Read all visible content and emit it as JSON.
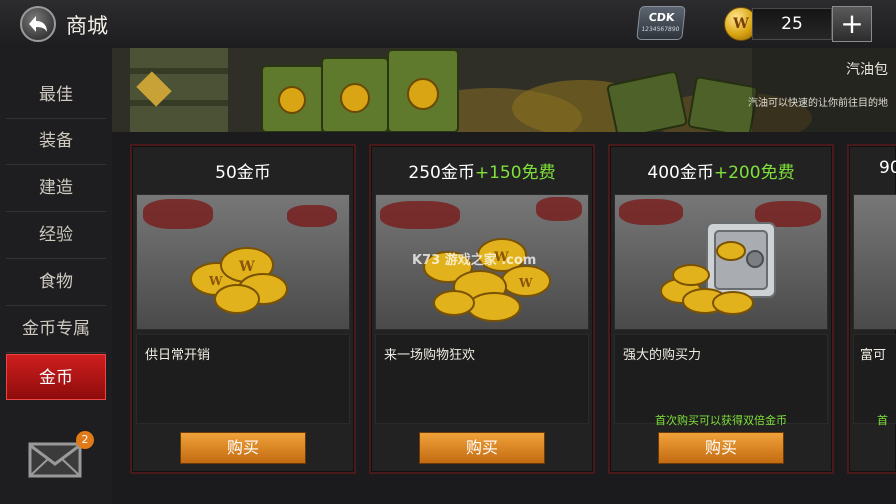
{
  "header": {
    "title": "商城",
    "cdk_label": "CDK",
    "cdk_sub": "1234567890",
    "coin_glyph": "W",
    "currency_amount": "25",
    "add_label": "+"
  },
  "sidebar": {
    "items": [
      {
        "label": "最佳",
        "active": false
      },
      {
        "label": "装备",
        "active": false
      },
      {
        "label": "建造",
        "active": false
      },
      {
        "label": "经验",
        "active": false
      },
      {
        "label": "食物",
        "active": false
      },
      {
        "label": "金币专属",
        "active": false
      },
      {
        "label": "金币",
        "active": true
      }
    ],
    "mail_badge": "2"
  },
  "banner": {
    "title": "汽油包",
    "description": "汽油可以快速的让你前往目的地"
  },
  "cards": [
    {
      "title": "50金币",
      "bonus": "",
      "description": "供日常开销",
      "note": "",
      "buy_label": "购买"
    },
    {
      "title": "250金币",
      "bonus": "+150免费",
      "description": "来一场购物狂欢",
      "note": "",
      "buy_label": "购买"
    },
    {
      "title": "400金币",
      "bonus": "+200免费",
      "description": "强大的购买力",
      "note": "首次购买可以获得双倍金币",
      "buy_label": "购买"
    },
    {
      "title": "90",
      "bonus": "",
      "description": "富可",
      "note": "首",
      "buy_label": ""
    }
  ],
  "watermark": "K73 游戏之家 .com",
  "colors": {
    "accent_red": "#c81818",
    "bonus_green": "#7fe03a",
    "buy_orange": "#e08a24",
    "gold": "#d9a514"
  }
}
